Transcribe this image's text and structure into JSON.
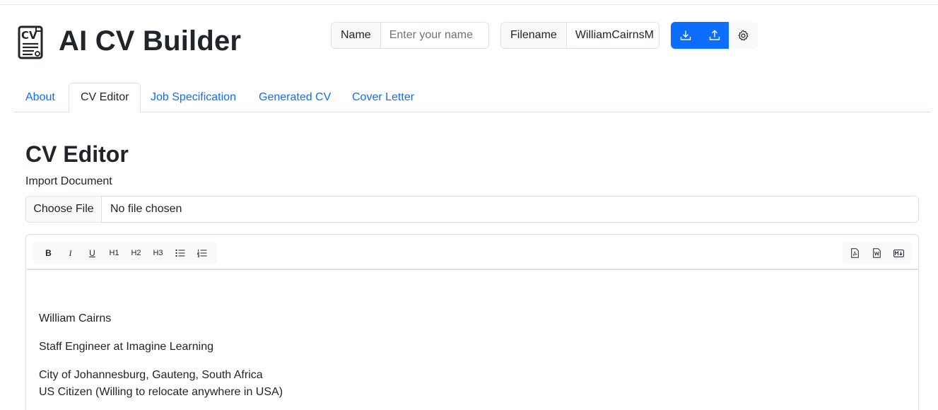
{
  "app": {
    "title": "AI CV Builder",
    "logo_icon": "cv-document-icon"
  },
  "header": {
    "name_label": "Name",
    "name_value": "",
    "name_placeholder": "Enter your name",
    "filename_label": "Filename",
    "filename_value": "WilliamCairnsM",
    "buttons": [
      {
        "icon": "download-icon"
      },
      {
        "icon": "upload-icon"
      },
      {
        "icon": "gear-icon"
      }
    ],
    "accent_color": "#0d6efd"
  },
  "tabs": [
    {
      "label": "About",
      "active": false
    },
    {
      "label": "CV Editor",
      "active": true
    },
    {
      "label": "Job Specification",
      "active": false
    },
    {
      "label": "Generated CV",
      "active": false
    },
    {
      "label": "Cover Letter",
      "active": false
    }
  ],
  "main": {
    "heading": "CV Editor",
    "import_label": "Import Document",
    "file_button": "Choose File",
    "file_status": "No file chosen"
  },
  "editor": {
    "toolbar": [
      "B",
      "I",
      "U",
      "H1",
      "H2",
      "H3"
    ],
    "list_icons": [
      "bullet-list-icon",
      "numbered-list-icon"
    ],
    "export_icons": [
      "pdf-export-icon",
      "word-export-icon",
      "markdown-export-icon"
    ],
    "content": [
      "William Cairns",
      "Staff Engineer at Imagine Learning",
      "City of Johannesburg, Gauteng, South Africa",
      "US Citizen (Willing to relocate anywhere in USA)"
    ]
  }
}
